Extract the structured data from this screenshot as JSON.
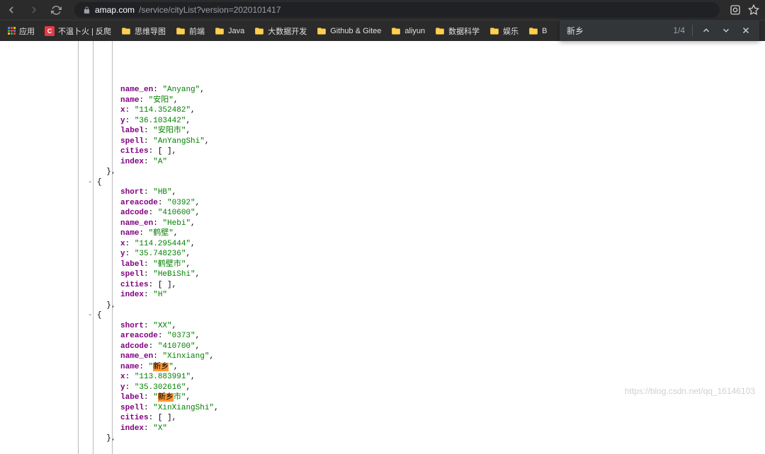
{
  "url": {
    "host": "amap.com",
    "path": "/service/cityList?version=2020101417"
  },
  "bookmarks": {
    "apps": "应用",
    "items": [
      "不温卜火 | 反爬",
      "思维导图",
      "前端",
      "Java",
      "大数据开发",
      "Github & Gitee",
      "aliyun",
      "数据科学",
      "娱乐",
      "B"
    ]
  },
  "find": {
    "query": "新乡",
    "count": "1/4"
  },
  "json": {
    "city1": {
      "name_en": "Anyang",
      "name": "安阳",
      "x": "114.352482",
      "y": "36.103442",
      "label": "安阳市",
      "spell": "AnYangShi",
      "cities": "[ ]",
      "index": "A"
    },
    "city2": {
      "short": "HB",
      "areacode": "0392",
      "adcode": "410600",
      "name_en": "Hebi",
      "name": "鹤壁",
      "x": "114.295444",
      "y": "35.748236",
      "label": "鹤壁市",
      "spell": "HeBiShi",
      "cities": "[ ]",
      "index": "H"
    },
    "city3": {
      "short": "XX",
      "areacode": "0373",
      "adcode": "410700",
      "name_en": "Xinxiang",
      "name": "新乡",
      "x": "113.883991",
      "y": "35.302616",
      "label": "新乡市",
      "spell": "XinXiangShi",
      "cities": "[ ]",
      "index": "X"
    }
  },
  "watermark": "https://blog.csdn.net/qq_16146103"
}
